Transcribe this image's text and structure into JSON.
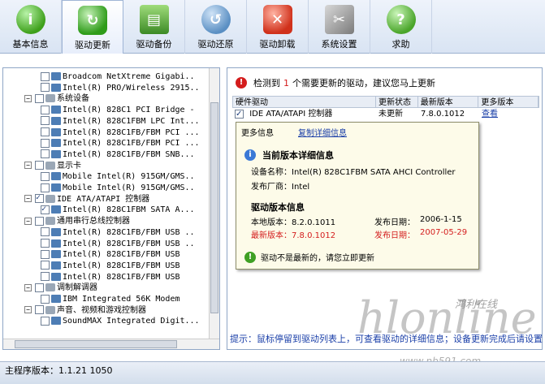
{
  "toolbar": {
    "items": [
      {
        "label": "基本信息",
        "icon": "info-icon"
      },
      {
        "label": "驱动更新",
        "icon": "update-icon"
      },
      {
        "label": "驱动备份",
        "icon": "backup-icon"
      },
      {
        "label": "驱动还原",
        "icon": "restore-icon"
      },
      {
        "label": "驱动卸载",
        "icon": "uninstall-icon"
      },
      {
        "label": "系统设置",
        "icon": "settings-icon"
      },
      {
        "label": "求助",
        "icon": "help-icon"
      }
    ],
    "active_index": 1
  },
  "tree": {
    "rows": [
      {
        "text": "Broadcom NetXtreme Gigabi..",
        "indent": 3,
        "checked": false
      },
      {
        "text": "Intel(R) PRO/Wireless 2915..",
        "indent": 3,
        "checked": false
      },
      {
        "text": "系统设备",
        "indent": 1,
        "checked": false,
        "category": true
      },
      {
        "text": "Intel(R) 828C1 PCI Bridge -",
        "indent": 3,
        "checked": false
      },
      {
        "text": "Intel(R) 828C1FBM LPC Int...",
        "indent": 3,
        "checked": false
      },
      {
        "text": "Intel(R) 828C1FB/FBM PCI ...",
        "indent": 3,
        "checked": false
      },
      {
        "text": "Intel(R) 828C1FB/FBM PCI ...",
        "indent": 3,
        "checked": false
      },
      {
        "text": "Intel(R) 828C1FB/FBM SNB...",
        "indent": 3,
        "checked": false
      },
      {
        "text": "显示卡",
        "indent": 1,
        "checked": false,
        "category": true
      },
      {
        "text": "Mobile Intel(R) 915GM/GMS..",
        "indent": 3,
        "checked": false
      },
      {
        "text": "Mobile Intel(R) 915GM/GMS..",
        "indent": 3,
        "checked": false
      },
      {
        "text": "IDE ATA/ATAPI 控制器",
        "indent": 1,
        "checked": true,
        "category": true
      },
      {
        "text": "Intel(R) 828C1FBM SATA A...",
        "indent": 3,
        "checked": true
      },
      {
        "text": "通用串行总线控制器",
        "indent": 1,
        "checked": false,
        "category": true
      },
      {
        "text": "Intel(R) 828C1FB/FBM USB ..",
        "indent": 3,
        "checked": false
      },
      {
        "text": "Intel(R) 828C1FB/FBM USB ..",
        "indent": 3,
        "checked": false
      },
      {
        "text": "Intel(R) 828C1FB/FBM USB",
        "indent": 3,
        "checked": false
      },
      {
        "text": "Intel(R) 828C1FB/FBM USB",
        "indent": 3,
        "checked": false
      },
      {
        "text": "Intel(R) 828C1FB/FBM USB",
        "indent": 3,
        "checked": false
      },
      {
        "text": "调制解调器",
        "indent": 1,
        "checked": false,
        "category": true
      },
      {
        "text": "IBM Integrated 56K Modem",
        "indent": 3,
        "checked": false
      },
      {
        "text": "声音、视频和游戏控制器",
        "indent": 1,
        "checked": false,
        "category": true
      },
      {
        "text": "SoundMAX Integrated Digit...",
        "indent": 3,
        "checked": false
      }
    ]
  },
  "alert": {
    "prefix": "检测到",
    "count": "1",
    "suffix": "个需要更新的驱动，建议您马上更新"
  },
  "table": {
    "headers": [
      "硬件驱动",
      "更新状态",
      "最新版本",
      "更多版本"
    ],
    "rows": [
      {
        "name": "IDE ATA/ATAPI 控制器",
        "status": "未更新",
        "version": "7.8.0.1012",
        "more": "查看"
      }
    ]
  },
  "popup": {
    "tab_more": "更多信息",
    "tab_copy": "复制详细信息",
    "title": "当前版本详细信息",
    "device_label": "设备名称：",
    "device_value": "Intel(R) 828C1FBM SATA AHCI Controller",
    "vendor_label": "发布厂商：",
    "vendor_value": "Intel",
    "driver_section": "驱动版本信息",
    "local_label": "本地版本：",
    "local_version": "8.2.0.1011",
    "local_date_label": "发布日期：",
    "local_date": "2006-1-15",
    "latest_label": "最新版本：",
    "latest_version": "7.8.0.1012",
    "latest_date_label": "发布日期：",
    "latest_date": "2007-05-29",
    "status_text": "驱动不是最新的，请您立即更新"
  },
  "hint": "提示：鼠标停留到驱动列表上，可查看驱动的详细信息；设备更新完成后请设置",
  "watermark": {
    "cn": "鸿利在线",
    "url": "www.nb591.com"
  },
  "statusbar": {
    "text": "主程序版本：1.1.21 1050"
  },
  "colors": {
    "accent_red": "#d41d1d",
    "link_blue": "#1a3fa8",
    "popup_bg": "#fdfbe9"
  }
}
